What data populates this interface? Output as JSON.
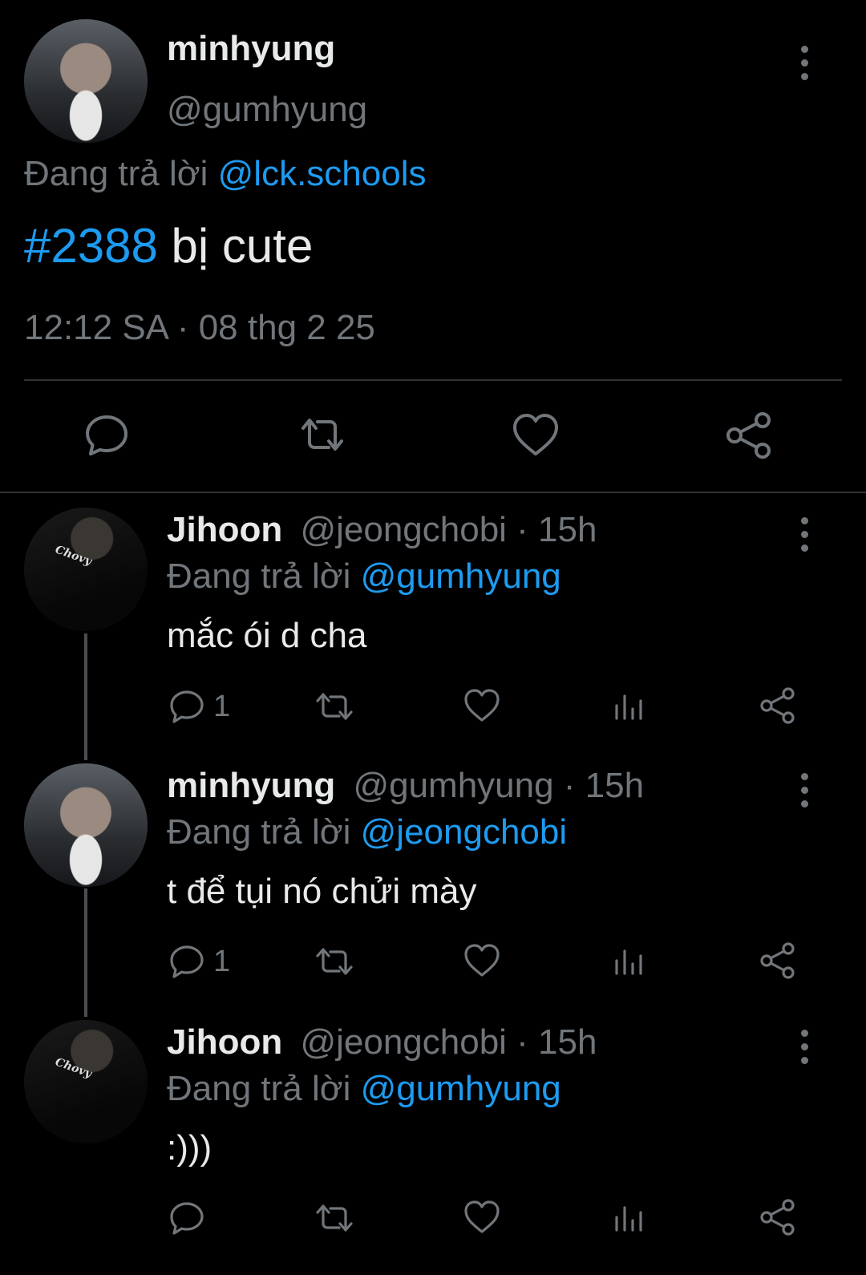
{
  "main_tweet": {
    "display_name": "minhyung",
    "handle": "@gumhyung",
    "replying_prefix": "Đang trả lời",
    "replying_to": "@lck.schools",
    "hashtag": "#2388",
    "text": " bị cute",
    "timestamp": "12:12 SA · 08 thg 2 25",
    "actions": {
      "reply_icon": "reply-icon",
      "retweet_icon": "retweet-icon",
      "like_icon": "heart-icon",
      "share_icon": "share-icon"
    }
  },
  "replies": [
    {
      "display_name": "Jihoon",
      "handle_time": "@jeongchobi · 15h",
      "replying_prefix": "Đang trả lời",
      "replying_to": "@gumhyung",
      "text": "mắc ói d cha",
      "reply_count": "1"
    },
    {
      "display_name": "minhyung",
      "handle_time": "@gumhyung · 15h",
      "replying_prefix": "Đang trả lời",
      "replying_to": "@jeongchobi",
      "text": "t để tụi nó chửi mày",
      "reply_count": "1"
    },
    {
      "display_name": "Jihoon",
      "handle_time": "@jeongchobi · 15h",
      "replying_prefix": "Đang trả lời",
      "replying_to": "@gumhyung",
      "text": ":)))",
      "reply_count": ""
    }
  ],
  "colors": {
    "background": "#000000",
    "text": "#e7e9ea",
    "muted": "#71767b",
    "accent": "#1d9bf0"
  }
}
